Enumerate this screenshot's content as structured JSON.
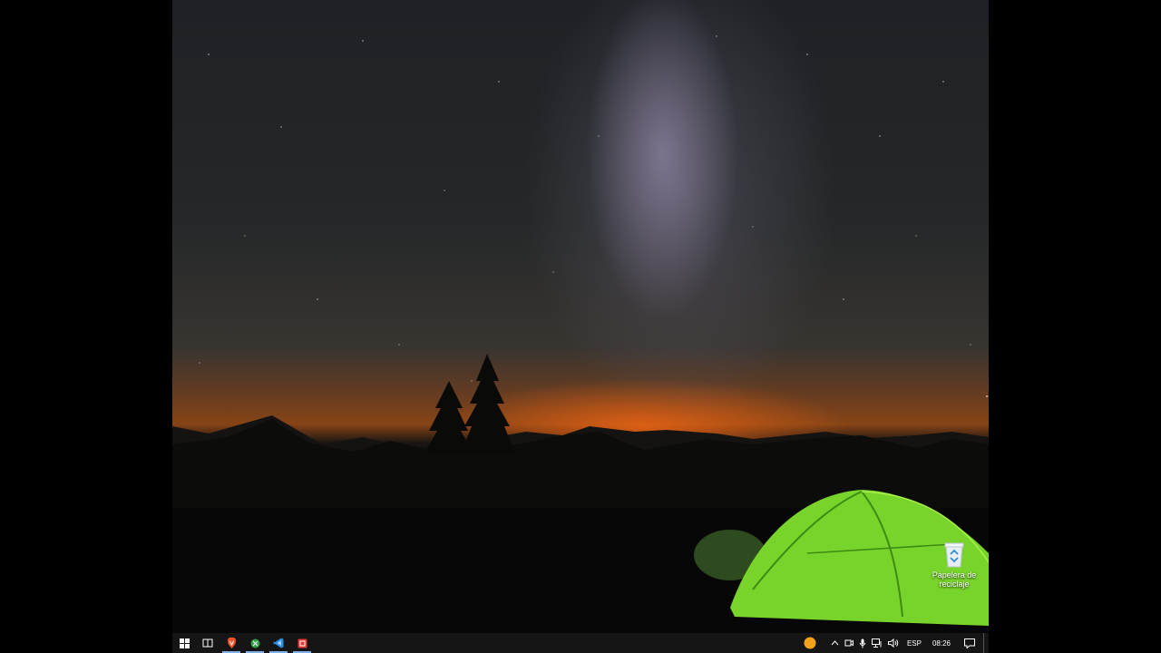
{
  "desktop": {
    "recycle_bin_label": "Papelera de reciclaje"
  },
  "taskbar": {
    "start_icon": "windows-start-icon",
    "pinned": [
      {
        "name": "task-view-icon"
      },
      {
        "name": "brave-browser-icon",
        "color": "#fb542b"
      },
      {
        "name": "xbox-icon",
        "color": "#2ea043"
      },
      {
        "name": "vscode-icon",
        "color": "#2b8fe4"
      },
      {
        "name": "app-red-icon",
        "color": "#e53935"
      }
    ],
    "tray": {
      "language": "ESP",
      "time": "08:26"
    }
  }
}
